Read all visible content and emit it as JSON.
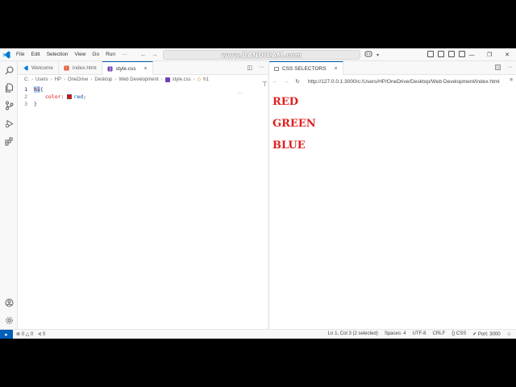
{
  "watermark": "www.BANDICAM.com",
  "titlebar": {
    "menu": [
      "File",
      "Edit",
      "Selection",
      "View",
      "Go",
      "Run",
      "···"
    ]
  },
  "editor": {
    "tabs": [
      {
        "label": "Welcome",
        "icon": "vscode-icon"
      },
      {
        "label": "index.html",
        "icon": "html-file-icon"
      },
      {
        "label": "style.css",
        "icon": "css-file-icon",
        "active": true,
        "close": "×"
      }
    ],
    "breadcrumb": [
      "C:",
      "Users",
      "HP",
      "OneDrive",
      "Desktop",
      "Web Development",
      "style.css",
      "h1"
    ],
    "code": {
      "line_numbers": [
        "1",
        "2",
        "3"
      ],
      "selector": "h1",
      "brace_open": "{",
      "property": "color",
      "colon": ":",
      "value": "red",
      "semicolon": ";",
      "brace_close": "}"
    },
    "more": "···"
  },
  "preview": {
    "tab_label": "CSS SELECTORS",
    "url": "http://127.0.0.1:3000/c:/Users/HP/OneDrive/Desktop/Web Development/index.html",
    "headings": [
      "RED",
      "GREEN",
      "BLUE"
    ]
  },
  "statusbar": {
    "problems_errors": "0",
    "problems_warnings": "0",
    "ports": "0",
    "cursor": "Ln 1, Col 3 (2 selected)",
    "spaces": "Spaces: 4",
    "encoding": "UTF-8",
    "eol": "CRLF",
    "language": "CSS",
    "port": "Port: 3000"
  },
  "colors": {
    "accent": "#005fb8",
    "heading_red": "#e01f1f",
    "selection": "#add6ff"
  }
}
